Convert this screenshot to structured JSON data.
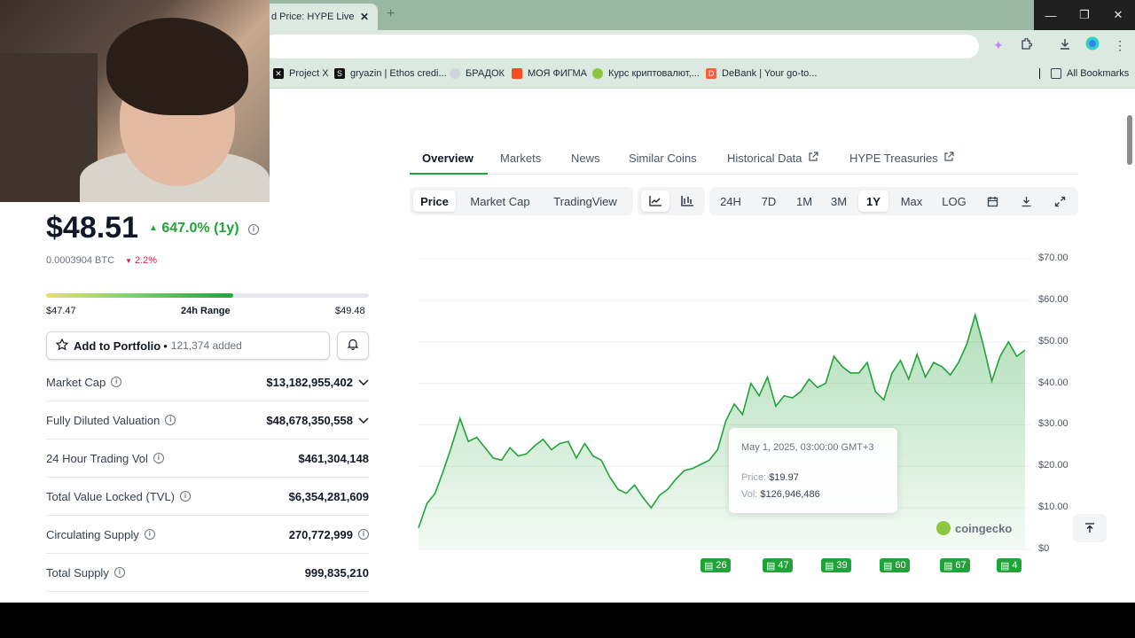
{
  "browser": {
    "tab_title": "d Price: HYPE Live Pri",
    "tab_close": "✕",
    "new_tab": "+",
    "window_controls": [
      "—",
      "❐",
      "✕"
    ],
    "bookmarks": [
      {
        "label": "Project X",
        "icon": "x-logo",
        "color": "#111111"
      },
      {
        "label": "gryazin | Ethos credi...",
        "icon": "ethos-logo",
        "color": "#111111"
      },
      {
        "label": "БРАДОК",
        "icon": "globe-icon",
        "color": "#9ca3af"
      },
      {
        "label": "МОЯ ФИГМА",
        "icon": "figma-logo",
        "color": "#f24e1e"
      },
      {
        "label": "Курс криптовалют,...",
        "icon": "coingecko-logo",
        "color": "#8dc63f"
      },
      {
        "label": "DeBank | Your go-to...",
        "icon": "debank-logo",
        "color": "#fe5e3a"
      }
    ],
    "all_bookmarks": "All Bookmarks"
  },
  "coin": {
    "price": "$48.51",
    "change": "647.0% (1y)",
    "btc_price": "0.0003904 BTC",
    "btc_change": "2.2%",
    "range_low": "$47.47",
    "range_label": "24h Range",
    "range_high": "$49.48",
    "range_fill": 0.58,
    "portfolio_label": "Add to Portfolio",
    "portfolio_sep": "•",
    "portfolio_added": "121,374 added",
    "stats": [
      {
        "label": "Market Cap",
        "value": "$13,182,955,402",
        "chevron": true
      },
      {
        "label": "Fully Diluted Valuation",
        "value": "$48,678,350,558",
        "chevron": true
      },
      {
        "label": "24 Hour Trading Vol",
        "value": "$461,304,148"
      },
      {
        "label": "Total Value Locked (TVL)",
        "value": "$6,354,281,609"
      },
      {
        "label": "Circulating Supply",
        "value": "270,772,999",
        "info_after": true
      },
      {
        "label": "Total Supply",
        "value": "999,835,210"
      }
    ]
  },
  "nav_tabs": [
    "Overview",
    "Markets",
    "News",
    "Similar Coins",
    "Historical Data",
    "HYPE Treasuries"
  ],
  "chart_tabs": [
    "Price",
    "Market Cap",
    "TradingView"
  ],
  "ranges": [
    "24H",
    "7D",
    "1M",
    "3M",
    "1Y",
    "Max",
    "LOG"
  ],
  "selected_range": "1Y",
  "tooltip": {
    "date": "May 1, 2025, 03:00:00 GMT+3",
    "price_label": "Price:",
    "price": "$19.97",
    "vol_label": "Vol:",
    "vol": "$126,946,486"
  },
  "watermark": "coingecko",
  "events": [
    "26",
    "47",
    "39",
    "60",
    "67",
    "4"
  ],
  "chart_data": {
    "type": "area",
    "ylim": [
      0,
      70
    ],
    "y_ticks": [
      "$70.00",
      "$60.00",
      "$50.00",
      "$40.00",
      "$30.00",
      "$20.00",
      "$10.00",
      "$0"
    ],
    "line_color": "#22a33a",
    "series": [
      {
        "values": [
          5.2,
          11,
          13.5,
          19,
          25,
          31.5,
          26,
          27,
          24.5,
          22,
          21.5,
          24.5,
          22.5,
          23,
          25,
          26.5,
          24,
          25.5,
          26,
          22,
          25.5,
          22.5,
          21.5,
          17.5,
          14.5,
          13.5,
          15.5,
          12.5,
          10,
          13,
          14.5,
          17,
          19,
          19.5,
          20.5,
          21.5,
          24,
          31,
          35,
          32.5,
          40,
          37,
          41.5,
          34.5,
          37,
          36.5,
          38,
          41,
          39,
          40,
          46.5,
          44,
          42.5,
          42.5,
          45,
          38,
          36,
          42.5,
          45.5,
          41,
          47,
          41.5,
          45,
          44,
          42,
          45,
          49.5,
          56.5,
          49,
          40.5,
          46.5,
          50,
          46.5,
          48
        ]
      }
    ]
  }
}
